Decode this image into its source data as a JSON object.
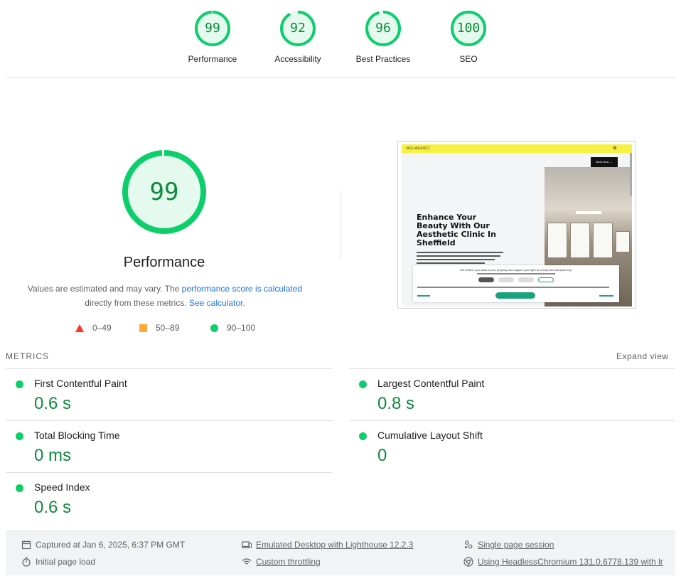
{
  "gauges": [
    {
      "score": "99",
      "label": "Performance"
    },
    {
      "score": "92",
      "label": "Accessibility"
    },
    {
      "score": "96",
      "label": "Best Practices"
    },
    {
      "score": "100",
      "label": "SEO"
    }
  ],
  "gauge_levels": [
    0.99,
    0.92,
    0.96,
    1.0
  ],
  "performance": {
    "score": "99",
    "level": 0.99,
    "title": "Performance",
    "desc_text1": "Values are estimated and may vary. The ",
    "desc_link1": "performance score is calculated",
    "desc_text2": "directly from these metrics. ",
    "desc_link2": "See calculator."
  },
  "legend": {
    "fail": "0–49",
    "average": "50–89",
    "pass": "90–100"
  },
  "screenshot": {
    "logo_text": "FACE ARCHITECT",
    "book_label": "Book Now →",
    "heading_line1": "Enhance Your",
    "heading_line2": "Beauty With Our",
    "heading_line3": "Aesthetic Clinic In",
    "heading_line4": "Sheffield",
    "cookie_title": "We believe your data is your property and support your right to privacy and transparency."
  },
  "metrics": {
    "header": "METRICS",
    "expand_label": "Expand view",
    "items": [
      {
        "title": "First Contentful Paint",
        "value": "0.6 s"
      },
      {
        "title": "Largest Contentful Paint",
        "value": "0.8 s"
      },
      {
        "title": "Total Blocking Time",
        "value": "0 ms"
      },
      {
        "title": "Cumulative Layout Shift",
        "value": "0"
      },
      {
        "title": "Speed Index",
        "value": "0.6 s"
      }
    ]
  },
  "footer": {
    "captured": "Captured at Jan 6, 2025, 6:37 PM GMT",
    "initial_load": "Initial page load",
    "emulated": "Emulated Desktop with Lighthouse 12.2.3",
    "throttling": "Custom throttling",
    "session": "Single page session",
    "browser": "Using HeadlessChromium 131.0.6778.139 with lr"
  },
  "colors": {
    "pass": "#0cce6b",
    "pass_text": "#0c8a3a",
    "pass_bg": "#e5faef",
    "average": "#ffaa33",
    "fail": "#ff3333"
  }
}
